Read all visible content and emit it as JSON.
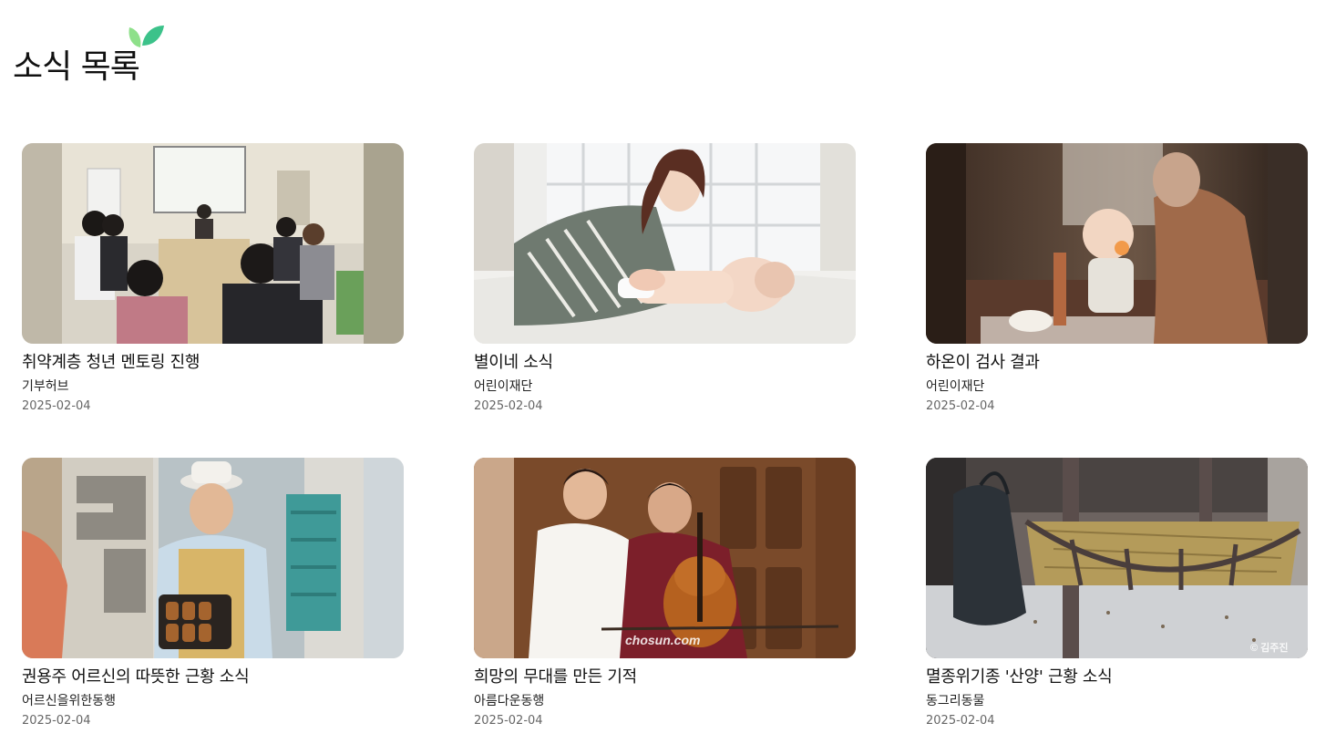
{
  "page": {
    "title": "소식 목록"
  },
  "news": [
    {
      "title": "취약계층 청년 멘토링 진행",
      "org": "기부허브",
      "date": "2025-02-04",
      "image": "mentoring-meeting-photo"
    },
    {
      "title": "별이네 소식",
      "org": "어린이재단",
      "date": "2025-02-04",
      "image": "mother-and-baby-photo"
    },
    {
      "title": "하온이 검사 결과",
      "org": "어린이재단",
      "date": "2025-02-04",
      "image": "child-eating-photo"
    },
    {
      "title": "권용주 어르신의 따뜻한 근황 소식",
      "org": "어르신을위한동행",
      "date": "2025-02-04",
      "image": "elderly-man-baking-photo"
    },
    {
      "title": "희망의 무대를 만든 기적",
      "org": "아름다운동행",
      "date": "2025-02-04",
      "image": "cello-lesson-photo",
      "watermark": "chosun.com"
    },
    {
      "title": "멸종위기종 '산양' 근황 소식",
      "org": "동그리동물",
      "date": "2025-02-04",
      "image": "hay-feeder-photo",
      "watermark": "© 김주진"
    }
  ],
  "colors": {
    "leaf_light": "#8ee08a",
    "leaf_dark": "#3cc28a"
  }
}
